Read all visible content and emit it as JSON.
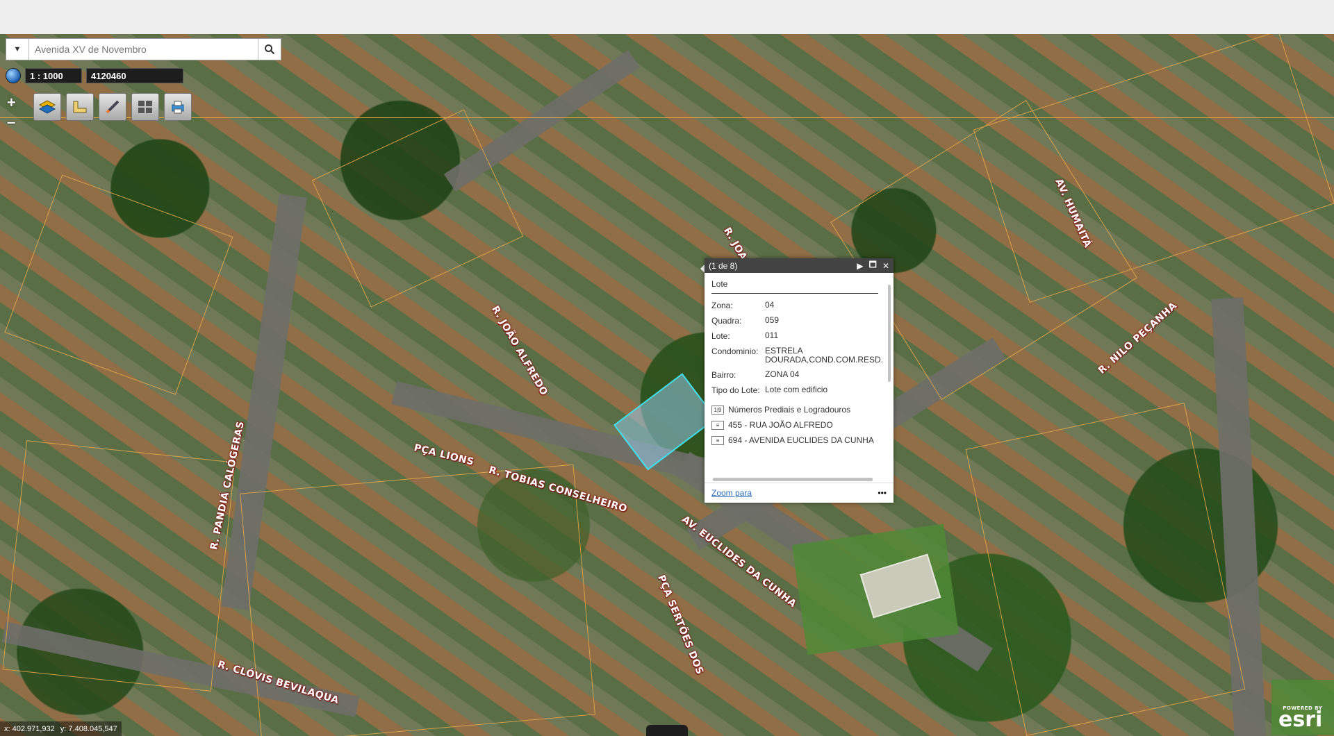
{
  "search": {
    "placeholder": "Avenida XV de Novembro",
    "dropdown_icon": "chevron-down-icon",
    "button_icon": "search-icon"
  },
  "scale": {
    "label": "1 : 1000",
    "value": "4120460"
  },
  "zoom": {
    "in": "+",
    "out": "–"
  },
  "toolbar": {
    "tools": [
      "layers-icon",
      "measure-icon",
      "draw-icon",
      "basemap-gallery-icon",
      "print-icon"
    ]
  },
  "popup": {
    "count": "(1 de 8)",
    "title": "Lote",
    "attributes": [
      {
        "key": "Zona:",
        "value": "04"
      },
      {
        "key": "Quadra:",
        "value": "059"
      },
      {
        "key": "Lote:",
        "value": "011"
      },
      {
        "key": "Condominio:",
        "value": "ESTRELA DOURADA,COND.COM.RESD."
      },
      {
        "key": "Bairro:",
        "value": "ZONA 04"
      },
      {
        "key": "Tipo do Lote:",
        "value": "Lote com edificio"
      }
    ],
    "related_title": "Números Prediais e Logradouros",
    "related_items": [
      "455 - RUA JOÃO ALFREDO",
      "694 - AVENIDA EUCLIDES DA CUNHA"
    ],
    "zoom_link": "Zoom para",
    "more": "•••"
  },
  "streets": [
    "R. JOAQUIM",
    "AV. HUMAITÁ",
    "R. NILO PEÇANHA",
    "R. JOÃO ALFREDO",
    "PÇA LIONS",
    "R. TOBIAS CONSELHEIRO",
    "R. PANDIÁ CALÓGERAS",
    "AV. EUCLIDES DA CUNHA",
    "PÇA SERTÕES DOS",
    "R. CLÓVIS BEVILAQUA"
  ],
  "coords": {
    "x": "x: 402.971,932",
    "y": "y: 7.408.045,547"
  },
  "branding": {
    "powered": "POWERED BY",
    "name": "esri"
  }
}
